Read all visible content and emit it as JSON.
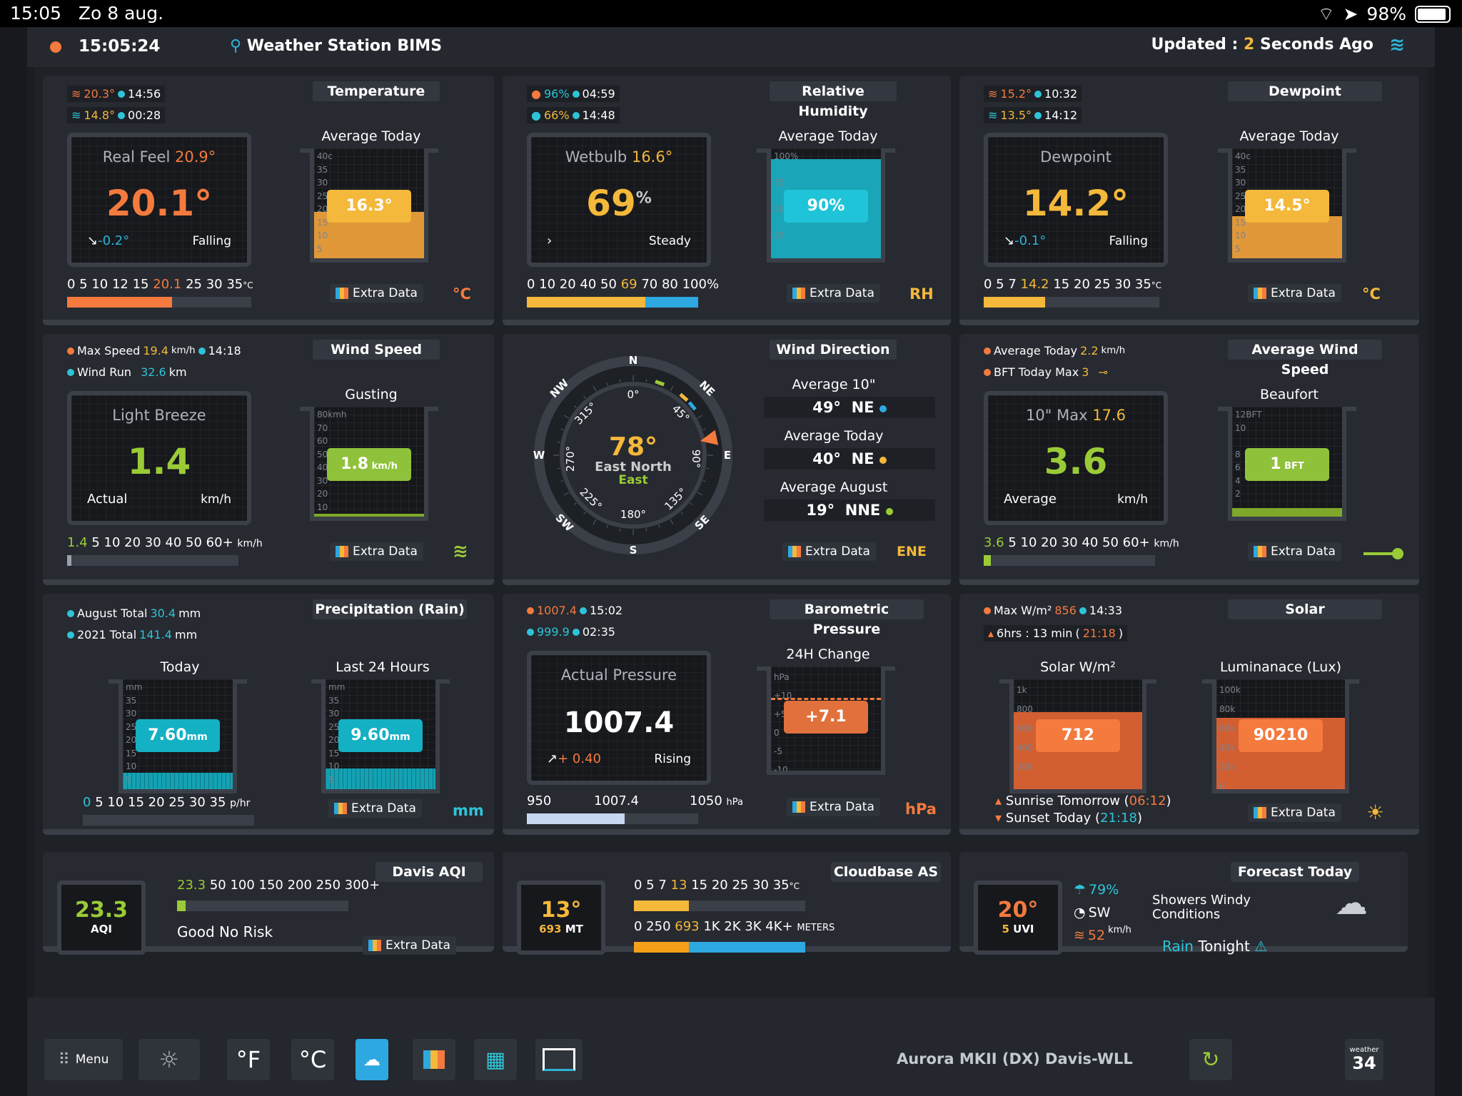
{
  "status": {
    "time": "15:05",
    "date": "Zo 8 aug.",
    "battery": "98%"
  },
  "header": {
    "clock": "15:05:24",
    "station": "Weather Station BIMS",
    "updated_prefix": "Updated :",
    "updated_n": "2",
    "updated_suffix": "Seconds Ago"
  },
  "temp": {
    "title": "Temperature",
    "hi": "20.3°",
    "hi_t": "14:56",
    "lo": "14.8°",
    "lo_t": "00:28",
    "rf_label": "Real Feel",
    "rf_val": "20.9°",
    "value": "20.1°",
    "trend": "-0.2°",
    "state": "Falling",
    "avg_label": "Average Today",
    "avg": "16.3°",
    "scale_a": "0 5 10 12 15",
    "scale_hi": "20.1",
    "scale_b": "25 30 35",
    "scale_u": "°C",
    "extra": "Extra Data",
    "unit": "°C",
    "fill": 0.57,
    "avg_fill": 0.42,
    "ticks": [
      "40c",
      "35",
      "30",
      "25",
      "20",
      "15",
      "10",
      "5"
    ]
  },
  "hum": {
    "title": "Relative Humidity",
    "hi": "96%",
    "hi_t": "04:59",
    "lo": "66%",
    "lo_t": "14:48",
    "wb_label": "Wetbulb",
    "wb_val": "16.6°",
    "value": "69",
    "pct": "%",
    "state": "Steady",
    "avg_label": "Average Today",
    "avg": "90%",
    "scale_a": "0 10 20 40 50",
    "scale_hi": "69",
    "scale_b": "70 80 100%",
    "extra": "Extra Data",
    "unit": "RH",
    "fill": 0.69,
    "avg_fill": 0.9,
    "ticks": [
      "100%",
      "",
      "75",
      "",
      "50",
      "",
      "25",
      ""
    ]
  },
  "dew": {
    "title": "Dewpoint",
    "hi": "15.2°",
    "hi_t": "10:32",
    "lo": "13.5°",
    "lo_t": "14:12",
    "label": "Dewpoint",
    "value": "14.2°",
    "trend": "-0.1°",
    "state": "Falling",
    "avg_label": "Average Today",
    "avg": "14.5°",
    "scale_a": "0 5 7",
    "scale_hi": "14.2",
    "scale_b": "15 20 25 30 35",
    "scale_u": "°C",
    "extra": "Extra Data",
    "unit": "°C",
    "fill": 0.35,
    "avg_fill": 0.38,
    "ticks": [
      "40c",
      "35",
      "30",
      "25",
      "20",
      "15",
      "10",
      "5"
    ]
  },
  "wind": {
    "title": "Wind Speed",
    "max_label": "Max Speed",
    "max": "19.4",
    "max_u": "km/h",
    "max_t": "14:18",
    "run_label": "Wind Run",
    "run": "32.6",
    "run_u": "km",
    "label": "Light Breeze",
    "value": "1.4",
    "bl": "Actual",
    "br": "km/h",
    "gust_label": "Gusting",
    "gust": "1.8",
    "gust_u": "km/h",
    "scale_hi": "1.4",
    "scale_b": "5 10 20 30 40 50 60+",
    "scale_u": "km/h",
    "extra": "Extra Data",
    "fill": 0.02,
    "gust_fill": 0.02,
    "ticks": [
      "80kmh",
      "70",
      "60",
      "50",
      "40",
      "30",
      "20",
      "10"
    ]
  },
  "dir": {
    "title": "Wind Direction",
    "deg": "78°",
    "name1": "East North",
    "name2": "East",
    "a10_label": "Average 10\"",
    "a10": "49°",
    "a10_d": "NE",
    "at_label": "Average Today",
    "at": "40°",
    "at_d": "NE",
    "am_label": "Average August",
    "am": "19°",
    "am_d": "NNE",
    "extra": "Extra Data",
    "unit": "ENE",
    "heading": 78,
    "N": "N",
    "NE": "NE",
    "E": "E",
    "SE": "SE",
    "S": "S",
    "SW": "SW",
    "W": "W",
    "NW": "NW",
    "d0": "0°",
    "d45": "45°",
    "d90": "90°",
    "d135": "135°",
    "d180": "180°",
    "d225": "225°",
    "d270": "270°",
    "d315": "315°"
  },
  "avgw": {
    "title": "Average Wind Speed",
    "at_label": "Average Today",
    "at": "2.2",
    "at_u": "km/h",
    "bft_label": "BFT Today Max",
    "bft": "3",
    "label": "10\" Max",
    "label_v": "17.6",
    "value": "3.6",
    "bl": "Average",
    "br": "km/h",
    "b_label": "Beaufort",
    "b_val": "1",
    "b_u": "BFT",
    "scale_hi": "3.6",
    "scale_b": "5 10 20 30 40 50 60+",
    "scale_u": "km/h",
    "extra": "Extra Data",
    "fill": 0.04,
    "b_fill": 0.08,
    "ticks": [
      "12BFT",
      "10",
      "",
      "8",
      "6",
      "4",
      "2",
      ""
    ]
  },
  "rain": {
    "title": "Precipitation (Rain)",
    "aug_label": "August Total",
    "aug": "30.4",
    "aug_u": "mm",
    "yr_label": "2021 Total",
    "yr": "141.4",
    "yr_u": "mm",
    "today_label": "Today",
    "today": "7.60",
    "today_u": "mm",
    "l24_label": "Last 24 Hours",
    "l24": "9.60",
    "l24_u": "mm",
    "scale_hi": "0",
    "scale_b": "5 10 15 20 25 30 35",
    "scale_u": "p/hr",
    "extra": "Extra Data",
    "unit": "mm",
    "t_fill": 0.15,
    "l_fill": 0.19,
    "ticks": [
      "mm",
      "35",
      "30",
      "25",
      "20",
      "15",
      "10",
      "5"
    ]
  },
  "baro": {
    "title": "Barometric Pressure",
    "hi": "1007.4",
    "hi_t": "15:02",
    "lo": "999.9",
    "lo_t": "02:35",
    "label": "Actual Pressure",
    "value": "1007.4",
    "trend": "+ 0.40",
    "state": "Rising",
    "chg_label": "24H Change",
    "chg": "+7.1",
    "lo_s": "950",
    "mid_s": "1007.4",
    "hi_s": "1050",
    "u_s": "hPa",
    "extra": "Extra Data",
    "unit": "hPa",
    "fill": 0.57,
    "ticks": [
      "hPa",
      "+10",
      "+5",
      "0",
      "-5",
      "-10"
    ]
  },
  "solar": {
    "title": "Solar",
    "max_label": "Max W/m²",
    "max": "856",
    "max_t": "14:33",
    "sun_hrs": "6hrs : 13 min",
    "sun_t": "21:18",
    "w_label": "Solar W/m²",
    "w": "712",
    "lux_label": "Luminanace (Lux)",
    "lux": "90210",
    "rise_label": "Sunrise Tomorrow",
    "rise": "06:12",
    "set_label": "Sunset Today",
    "set": "21:18",
    "extra": "Extra Data",
    "w_fill": 0.7,
    "l_fill": 0.65,
    "w_ticks": [
      "1k",
      "800",
      "600",
      "400",
      "200",
      ""
    ],
    "l_ticks": [
      "100k",
      "80k",
      "60k",
      "40k",
      "20k",
      "0"
    ]
  },
  "aqi": {
    "title": "Davis AQI",
    "value": "23.3",
    "unit": "AQI",
    "scale_hi": "23.3",
    "scale_b": "50 100 150 200 250 300+",
    "text": "Good No Risk",
    "extra": "Extra Data",
    "fill": 0.05
  },
  "cloud": {
    "title": "Cloudbase AS",
    "value": "13°",
    "sub": "693",
    "sub_u": "MT",
    "s1a": "0 5 7",
    "s1h": "13",
    "s1b": "15 20 25 30 35",
    "s1u": "°C",
    "s2a": "0 250",
    "s2h": "693",
    "s2b": "1K 2K 3K 4K+",
    "s2u": "METERS",
    "f1": 0.32,
    "f2": 0.32
  },
  "fc": {
    "title": "Forecast Today",
    "temp": "20°",
    "uvi_n": "5",
    "uvi": "UVI",
    "rain": "79%",
    "dir": "SW",
    "spd": "52",
    "spd_u": "km/h",
    "text1": "Showers Windy",
    "text2": "Conditions",
    "rain_t": "Rain",
    "tonight": "Tonight"
  },
  "taskbar": {
    "menu": "Menu",
    "f": "°F",
    "c": "°C",
    "device": "Aurora MKII (DX) Davis-WLL",
    "wx_small": "weather",
    "wx": "34"
  }
}
